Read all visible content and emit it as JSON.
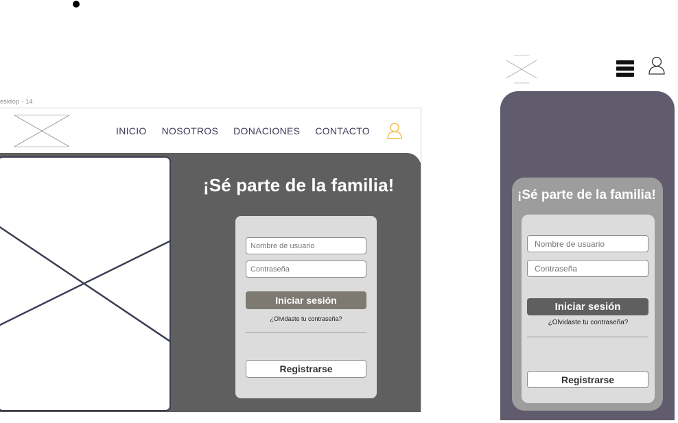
{
  "frame": {
    "label": "esktop - 14"
  },
  "nav": {
    "items": [
      "INICIO",
      "NOSOTROS",
      "DONACIONES",
      "CONTACTO"
    ],
    "active_color": "#f0b94a"
  },
  "desktop": {
    "heading": "¡Sé parte de la familia!",
    "login": {
      "username_placeholder": "Nombre de usuario",
      "password_placeholder": "Contraseña",
      "login_label": "Iniciar sesión",
      "forgot_label": "¿Olvidaste tu contraseña?",
      "register_label": "Registrarse"
    }
  },
  "mobile": {
    "heading": "¡Sé parte de la familia!",
    "login": {
      "username_placeholder": "Nombre de usuario",
      "password_placeholder": "Contraseña",
      "login_label": "Iniciar sesión",
      "forgot_label": "¿Olvidaste tu contraseña?",
      "register_label": "Registrarse"
    }
  },
  "icons": {
    "logo": "image-placeholder-icon",
    "user": "user-icon",
    "menu": "hamburger-menu-icon"
  },
  "colors": {
    "hero_bg": "#5f5f5f",
    "mobile_bg": "#605c6d",
    "card_bg": "#dcdcdc",
    "login_button_desktop": "#7d7a72",
    "login_button_mobile": "#5f5f5f",
    "user_icon_desktop": "#f0b94a"
  }
}
